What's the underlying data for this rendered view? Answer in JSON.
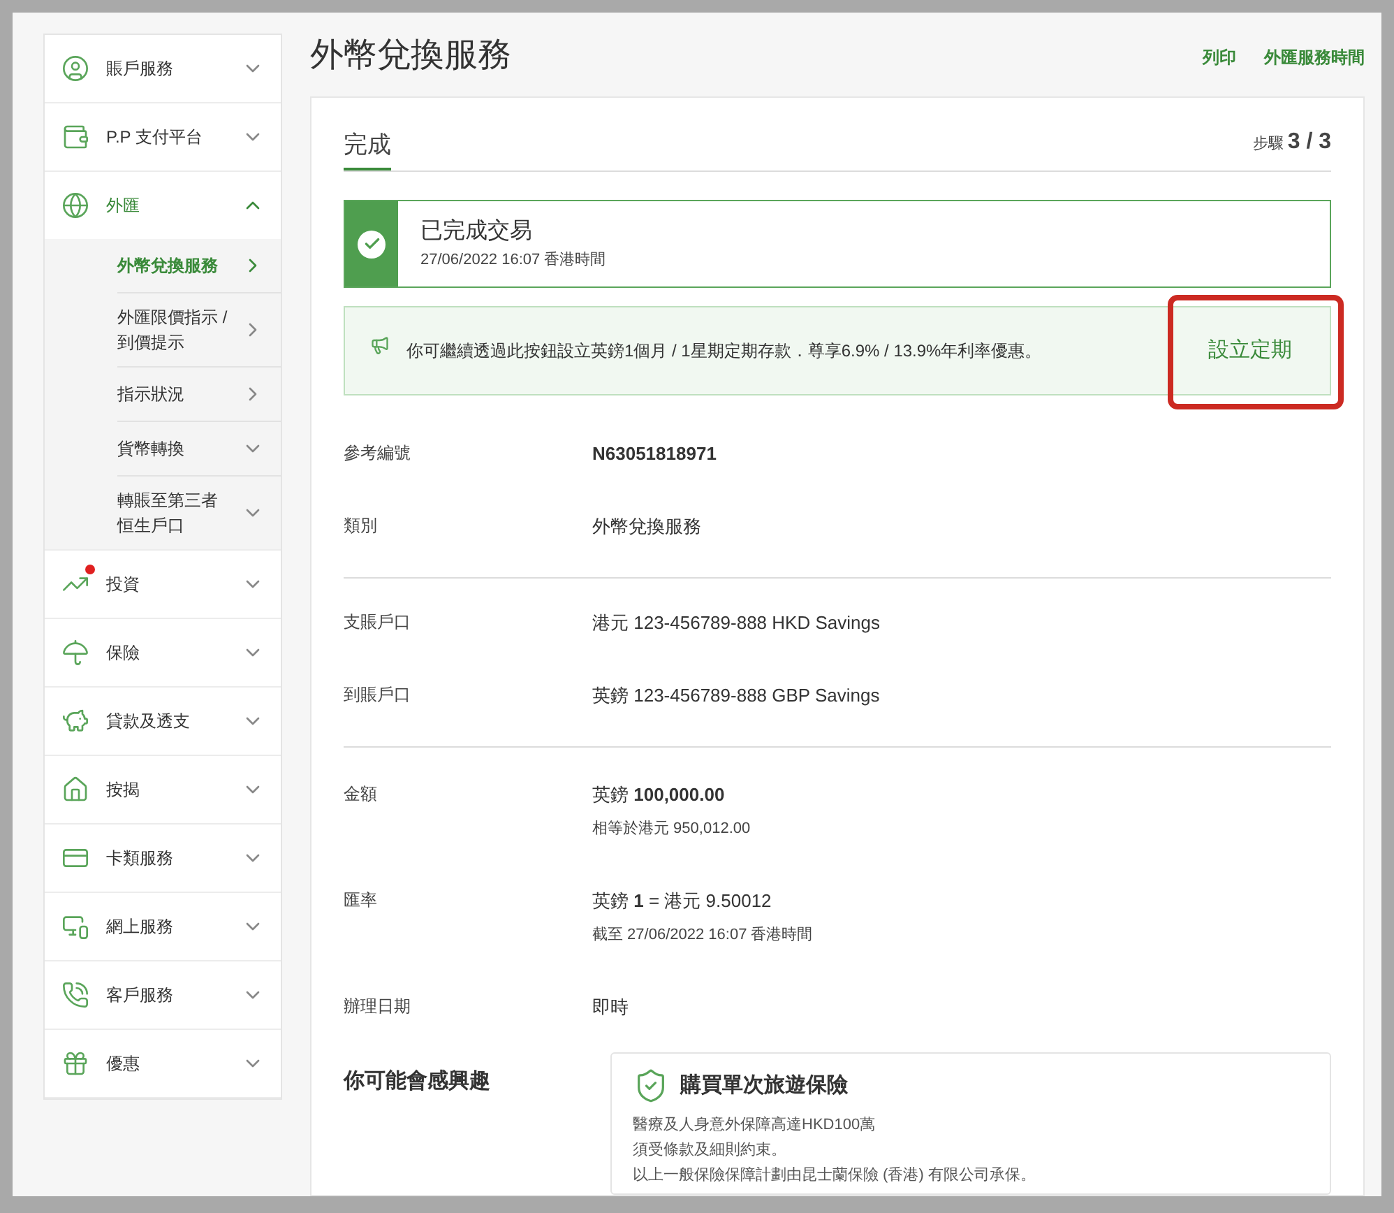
{
  "sidebar": {
    "items": [
      {
        "label": "賬戶服務",
        "expanded": false
      },
      {
        "label": "P.P 支付平台",
        "expanded": false
      },
      {
        "label": "外匯",
        "expanded": true,
        "children": [
          {
            "label": "外幣兌換服務",
            "kind": "link",
            "selected": true
          },
          {
            "label": "外匯限價指示 / 到價提示",
            "kind": "link",
            "selected": false
          },
          {
            "label": "指示狀況",
            "kind": "link",
            "selected": false
          },
          {
            "label": "貨幣轉換",
            "kind": "group",
            "selected": false
          },
          {
            "label": "轉賬至第三者恒生戶口",
            "kind": "group",
            "selected": false
          }
        ]
      },
      {
        "label": "投資",
        "expanded": false,
        "notification": true
      },
      {
        "label": "保險",
        "expanded": false
      },
      {
        "label": "貸款及透支",
        "expanded": false
      },
      {
        "label": "按揭",
        "expanded": false
      },
      {
        "label": "卡類服務",
        "expanded": false
      },
      {
        "label": "網上服務",
        "expanded": false
      },
      {
        "label": "客戶服務",
        "expanded": false
      },
      {
        "label": "優惠",
        "expanded": false
      }
    ]
  },
  "page": {
    "title": "外幣兌換服務",
    "links": [
      "列印",
      "外匯服務時間"
    ]
  },
  "step": {
    "tab": "完成",
    "label": "步驟",
    "count": "3 / 3"
  },
  "success": {
    "title": "已完成交易",
    "time": "27/06/2022 16:07 香港時間"
  },
  "promo": {
    "text": "你可繼續透過此按鈕設立英鎊1個月 / 1星期定期存款．尊享6.9% / 13.9%年利率優惠。",
    "button": "設立定期",
    "highlighted": true
  },
  "details": [
    [
      {
        "label": "參考編號",
        "value": "**N63051818971**"
      },
      {
        "label": "類別",
        "value": "外幣兌換服務"
      }
    ],
    [
      {
        "label": "支賬戶口",
        "value": "港元 123-456789-888  HKD Savings"
      },
      {
        "label": "到賬戶口",
        "value": "英鎊 123-456789-888  GBP Savings"
      }
    ],
    [
      {
        "label": "金額",
        "value": "英鎊 **100,000.00**",
        "note": "相等於港元  950,012.00"
      },
      {
        "label": "匯率",
        "value": "英鎊 **1** = 港元 9.50012",
        "note": "截至  27/06/2022 16:07  香港時間"
      },
      {
        "label": "辦理日期",
        "value": "即時"
      }
    ]
  ],
  "interest": {
    "heading": "你可能會感興趣",
    "card": {
      "title": "購買單次旅遊保險",
      "lines": [
        "醫療及人身意外保障高達HKD100萬",
        "須受條款及細則約束。",
        "以上一般保險保障計劃由昆士蘭保險 (香港) 有限公司承保。"
      ]
    }
  }
}
